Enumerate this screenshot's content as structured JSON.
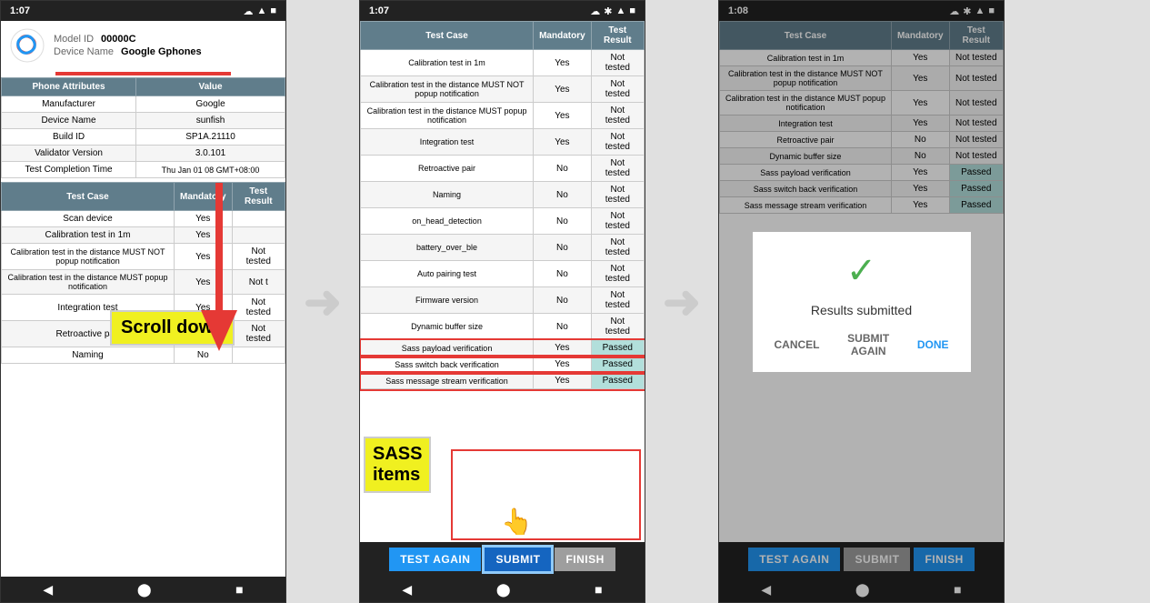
{
  "phone1": {
    "status_bar": {
      "time": "1:07",
      "icons": "⊆ ψ ▲ ▲ ◼ ■"
    },
    "device": {
      "model_id_label": "Model ID",
      "model_id_value": "00000C",
      "device_name_label": "Device Name",
      "device_name_value": "Google Gphones"
    },
    "attributes_table": {
      "headers": [
        "Phone Attributes",
        "Value"
      ],
      "rows": [
        [
          "Manufacturer",
          "Google"
        ],
        [
          "Device Name",
          "sunfish"
        ],
        [
          "Build ID",
          "SP1A.21110"
        ],
        [
          "Validator Version",
          "3.0.101"
        ],
        [
          "Test Completion Time",
          "Thu Jan 01 08 GMT+08:00"
        ]
      ]
    },
    "test_table": {
      "headers": [
        "Test Case",
        "Mandatory",
        "Test Result"
      ],
      "rows": [
        [
          "Scan device",
          "Yes",
          ""
        ],
        [
          "Calibration test in 1m",
          "Yes",
          ""
        ],
        [
          "Calibration test in the distance MUST NOT popup notification",
          "Yes",
          "Not tested"
        ],
        [
          "Calibration test in the distance MUST popup notification",
          "Yes",
          "Not t"
        ],
        [
          "Integration test",
          "Yes",
          "Not tested"
        ],
        [
          "Retroactive pair",
          "No",
          "Not tested"
        ],
        [
          "Naming",
          "No",
          ""
        ]
      ]
    },
    "scroll_down_label": "Scroll down"
  },
  "arrow1": "➤",
  "phone2": {
    "status_bar": {
      "time": "1:07",
      "icons": "⊆ ψ ▲ ▲ ◼ ■"
    },
    "table": {
      "headers": [
        "Test Case",
        "Mandatory",
        "Test Result"
      ],
      "rows": [
        [
          "Calibration test in 1m",
          "Yes",
          "Not tested"
        ],
        [
          "Calibration test in the distance MUST NOT popup notification",
          "Yes",
          "Not tested"
        ],
        [
          "Calibration test in the distance MUST popup notification",
          "Yes",
          "Not tested"
        ],
        [
          "Integration test",
          "Yes",
          "Not tested"
        ],
        [
          "Retroactive pair",
          "No",
          "Not tested"
        ],
        [
          "Naming",
          "No",
          "Not tested"
        ],
        [
          "on_head_detection",
          "No",
          "Not tested"
        ],
        [
          "battery_over_ble",
          "No",
          "Not tested"
        ],
        [
          "Auto pairing test",
          "No",
          "Not tested"
        ],
        [
          "Firmware version",
          "No",
          "Not tested"
        ],
        [
          "Dynamic buffer size",
          "No",
          "Not tested"
        ],
        [
          "Sass payload verification",
          "Yes",
          "Passed"
        ],
        [
          "Sass switch back verification",
          "Yes",
          "Passed"
        ],
        [
          "Sass message stream verification",
          "Yes",
          "Passed"
        ]
      ]
    },
    "sass_label": "SASS\nitems",
    "buttons": {
      "test_again": "TEST AGAIN",
      "submit": "SUBMIT",
      "finish": "FINISH"
    },
    "submit_annotation": "submit"
  },
  "arrow2": "➤",
  "phone3": {
    "status_bar": {
      "time": "1:08",
      "icons": "⊆ ψ ▲ ▲ ◼ ■"
    },
    "table": {
      "headers": [
        "Test Case",
        "Mandatory",
        "Test Result"
      ],
      "rows": [
        [
          "Calibration test in 1m",
          "Yes",
          "Not tested"
        ],
        [
          "Calibration test in the distance MUST NOT popup notification",
          "Yes",
          "Not tested"
        ],
        [
          "Calibration test in the distance MUST popup notification",
          "Yes",
          "Not tested"
        ],
        [
          "Integration test",
          "Yes",
          "Not tested"
        ],
        [
          "Retroactive pair",
          "No",
          "Not tested"
        ],
        [
          "Dynamic buffer size",
          "No",
          "Not tested"
        ],
        [
          "Sass payload verification",
          "Yes",
          "Passed"
        ],
        [
          "Sass switch back verification",
          "Yes",
          "Passed"
        ],
        [
          "Sass message stream verification",
          "Yes",
          "Passed"
        ]
      ]
    },
    "dialog": {
      "check_icon": "✓",
      "title": "Results submitted",
      "cancel_label": "CANCEL",
      "submit_again_label": "SUBMIT AGAIN",
      "done_label": "DONE"
    },
    "buttons": {
      "test_again": "TEST AGAIN",
      "submit": "SUBMIT",
      "finish": "FINISH"
    }
  }
}
